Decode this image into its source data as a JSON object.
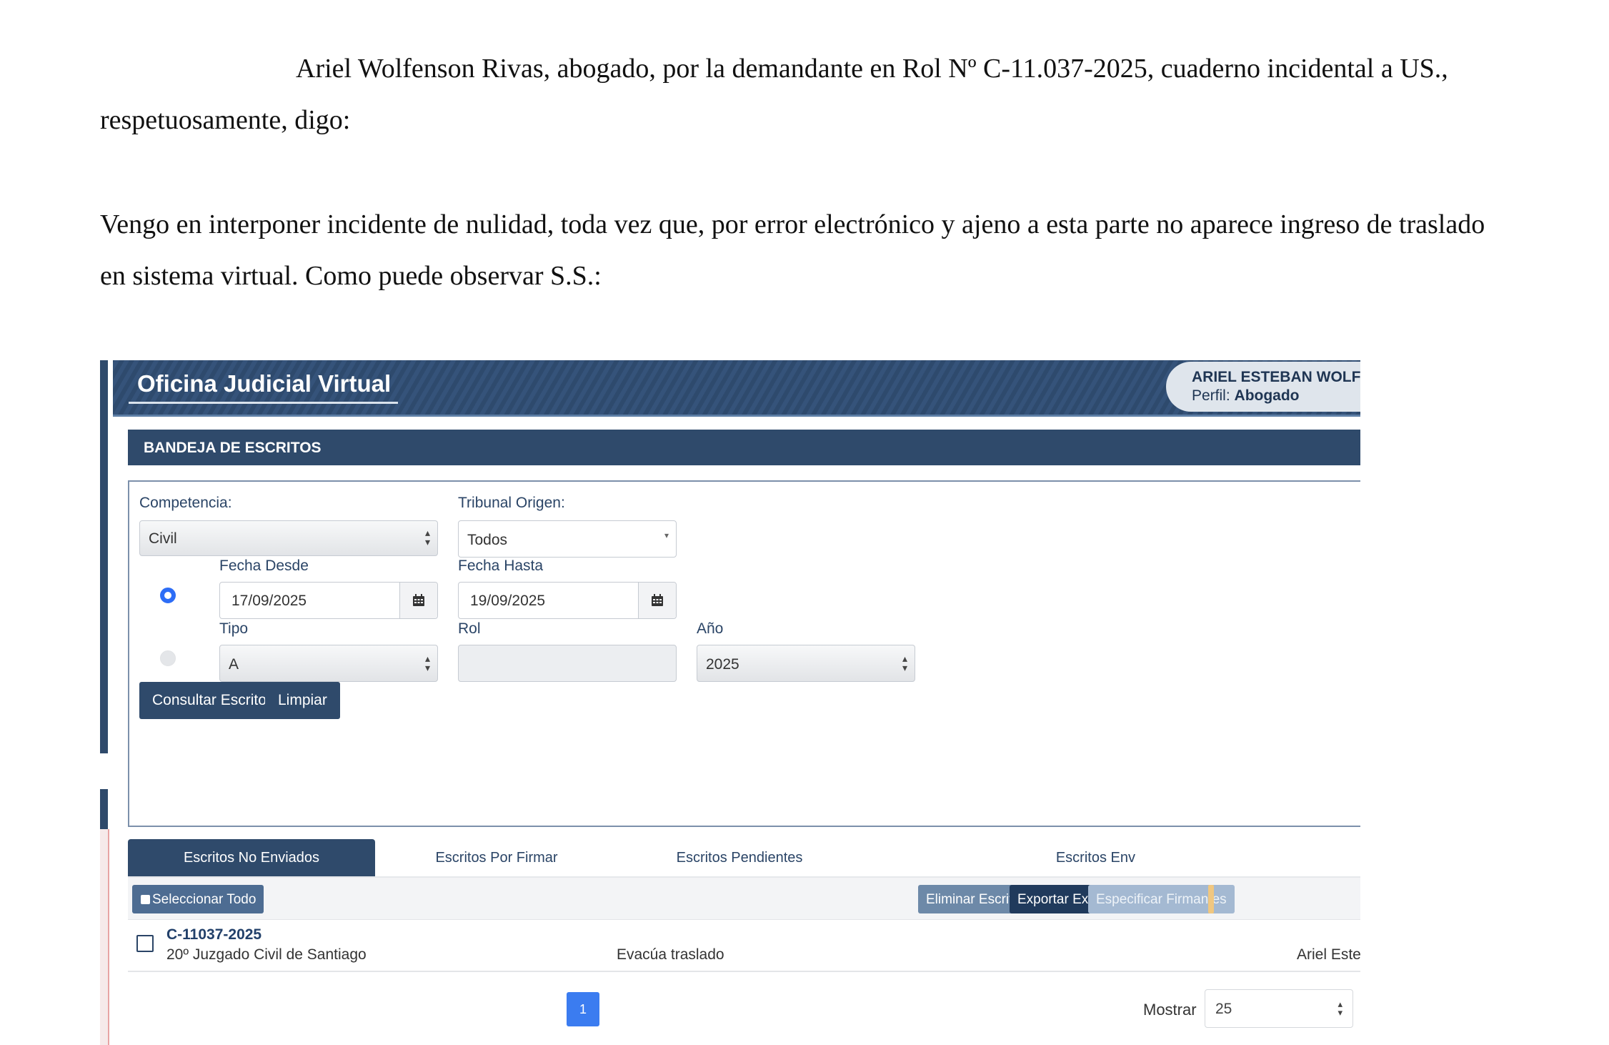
{
  "document": {
    "paragraph1_line1": "Ariel Wolfenson Rivas, abogado, por la demandante en Rol Nº C-11.037-2025, cuaderno incidental a US.,",
    "paragraph1_line2": "respetuosamente, digo:",
    "paragraph2_line1": "Vengo en interponer incidente de nulidad, toda vez que, por error electrónico y ajeno a esta parte no aparece ingreso de traslado",
    "paragraph2_line2": "en sistema virtual. Como puede observar S.S.:"
  },
  "app": {
    "title": "Oficina Judicial Virtual",
    "user_name": "ARIEL ESTEBAN WOLFE",
    "profile_label": "Perfil:",
    "profile_value": "Abogado",
    "section_title": "BANDEJA DE ESCRITOS"
  },
  "filters": {
    "competencia_label": "Competencia:",
    "competencia_value": "Civil",
    "tribunal_label": "Tribunal Origen:",
    "tribunal_value": "Todos",
    "fecha_desde_label": "Fecha Desde",
    "fecha_desde_value": "17/09/2025",
    "fecha_hasta_label": "Fecha Hasta",
    "fecha_hasta_value": "19/09/2025",
    "tipo_label": "Tipo",
    "tipo_value": "A",
    "rol_label": "Rol",
    "rol_value": "",
    "anio_label": "Año",
    "anio_value": "2025",
    "consultar_button": "Consultar Escritos",
    "limpiar_button": "Limpiar",
    "selected_mode": "fecha"
  },
  "tabs": [
    {
      "label": "Escritos No Enviados",
      "active": true
    },
    {
      "label": "Escritos Por Firmar",
      "active": false
    },
    {
      "label": "Escritos Pendientes",
      "active": false
    },
    {
      "label": "Escritos Env",
      "active": false
    }
  ],
  "toolbar": {
    "select_all": "Seleccionar Todo",
    "eliminar": "Eliminar Escritos",
    "exportar": "Exportar Excel",
    "firmantes": "Especificar Firmantes"
  },
  "rows": [
    {
      "rol": "C-11037-2025",
      "tribunal": "20º Juzgado Civil de Santiago",
      "tipo": "Evacúa traslado",
      "firmante": "Ariel Esteban V"
    }
  ],
  "pagination": {
    "current_page": "1",
    "mostrar_label": "Mostrar",
    "mostrar_value": "25"
  },
  "colors": {
    "header": "#2e4a6d",
    "primary_button": "#2f4a6b",
    "page_active": "#3b7cf0",
    "radio_active": "#2d6df6"
  }
}
